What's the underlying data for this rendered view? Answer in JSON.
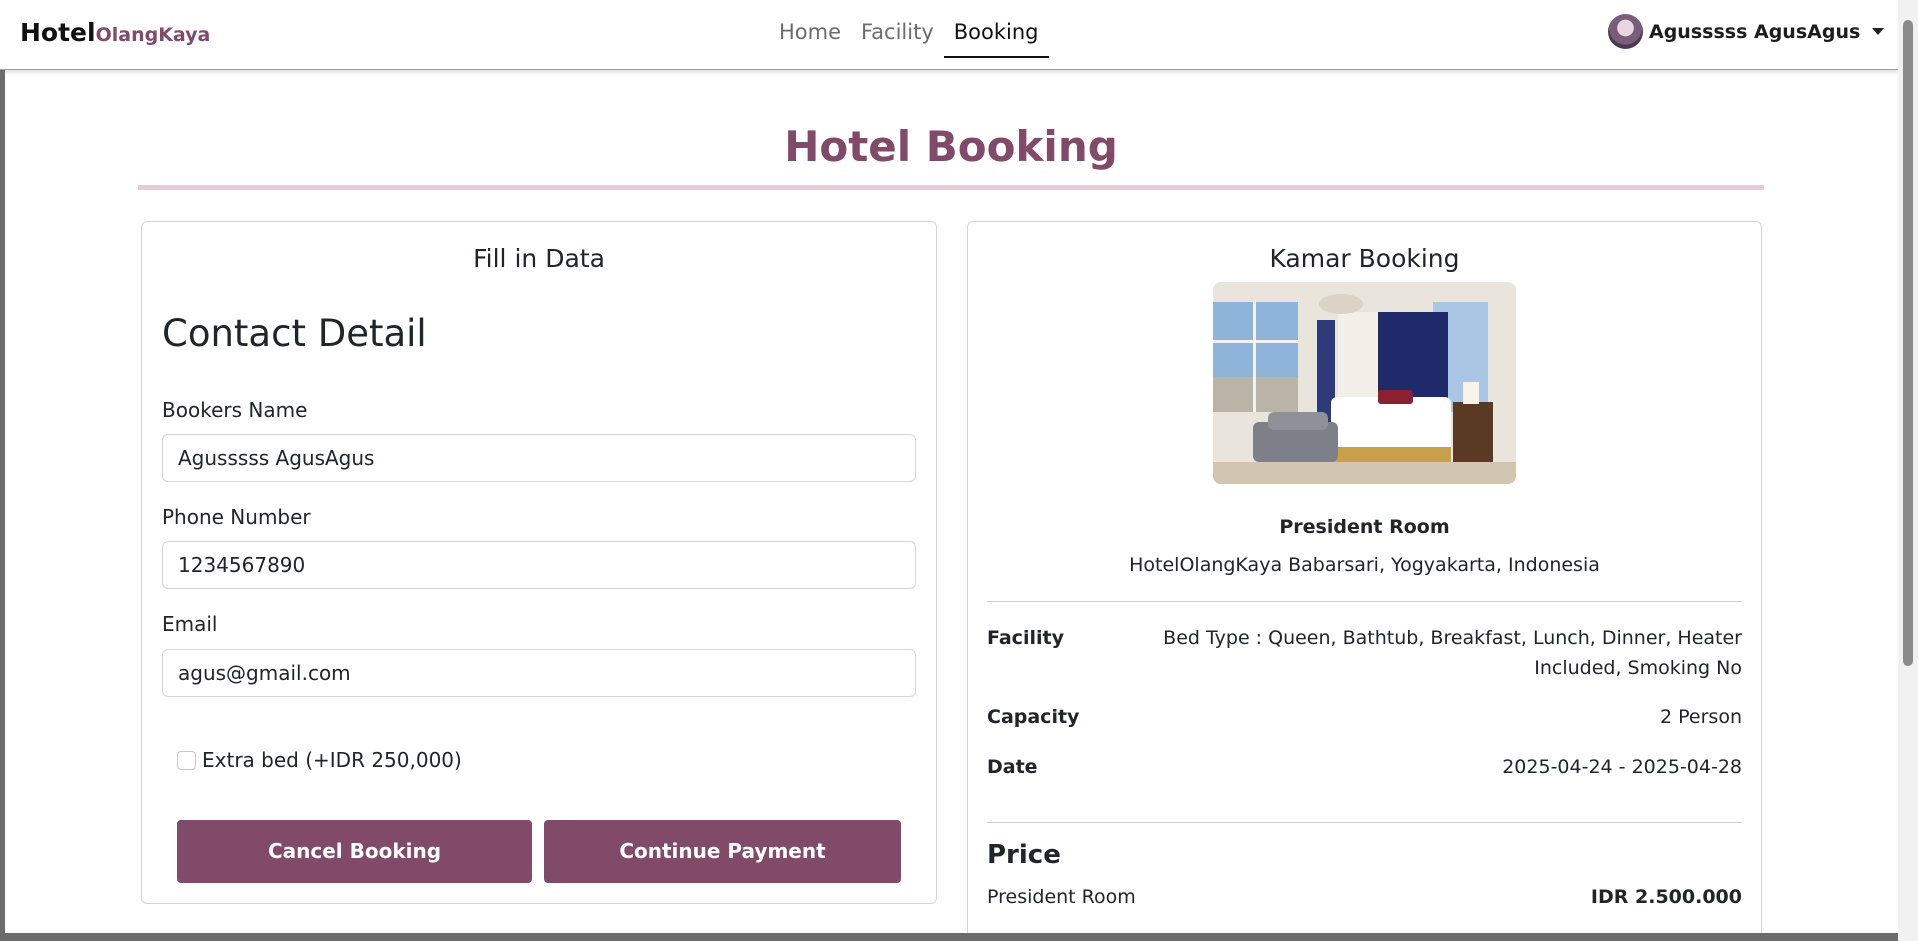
{
  "navbar": {
    "brand_main": "Hotel",
    "brand_sub": "OlangKaya",
    "links": [
      {
        "label": "Home",
        "active": false
      },
      {
        "label": "Facility",
        "active": false
      },
      {
        "label": "Booking",
        "active": true
      }
    ],
    "user_name": "Agusssss AgusAgus"
  },
  "page": {
    "title": "Hotel Booking"
  },
  "form_card": {
    "heading": "Fill in Data",
    "section_title": "Contact Detail",
    "fields": {
      "name": {
        "label": "Bookers Name",
        "value": "Agusssss AgusAgus"
      },
      "phone": {
        "label": "Phone Number",
        "value": "1234567890"
      },
      "email": {
        "label": "Email",
        "value": "agus@gmail.com"
      }
    },
    "extra_bed": {
      "label": "Extra bed (+IDR 250,000)",
      "checked": false
    },
    "cancel_label": "Cancel Booking",
    "continue_label": "Continue Payment"
  },
  "booking_card": {
    "heading": "Kamar Booking",
    "room_name": "President Room",
    "location": "HotelOlangKaya Babarsari, Yogyakarta, Indonesia",
    "facility_label": "Facility",
    "facility_line1": "Bed Type : Queen, Bathtub, Breakfast, Lunch, Dinner, Heater",
    "facility_line2": "Included, Smoking No",
    "capacity_label": "Capacity",
    "capacity_value": "2 Person",
    "date_label": "Date",
    "date_value": "2025-04-24 - 2025-04-28",
    "price_title": "Price",
    "price_item": "President Room",
    "price_amount": "IDR 2.500.000"
  },
  "colors": {
    "accent": "#814a68",
    "rule": "#e3cdd8"
  }
}
